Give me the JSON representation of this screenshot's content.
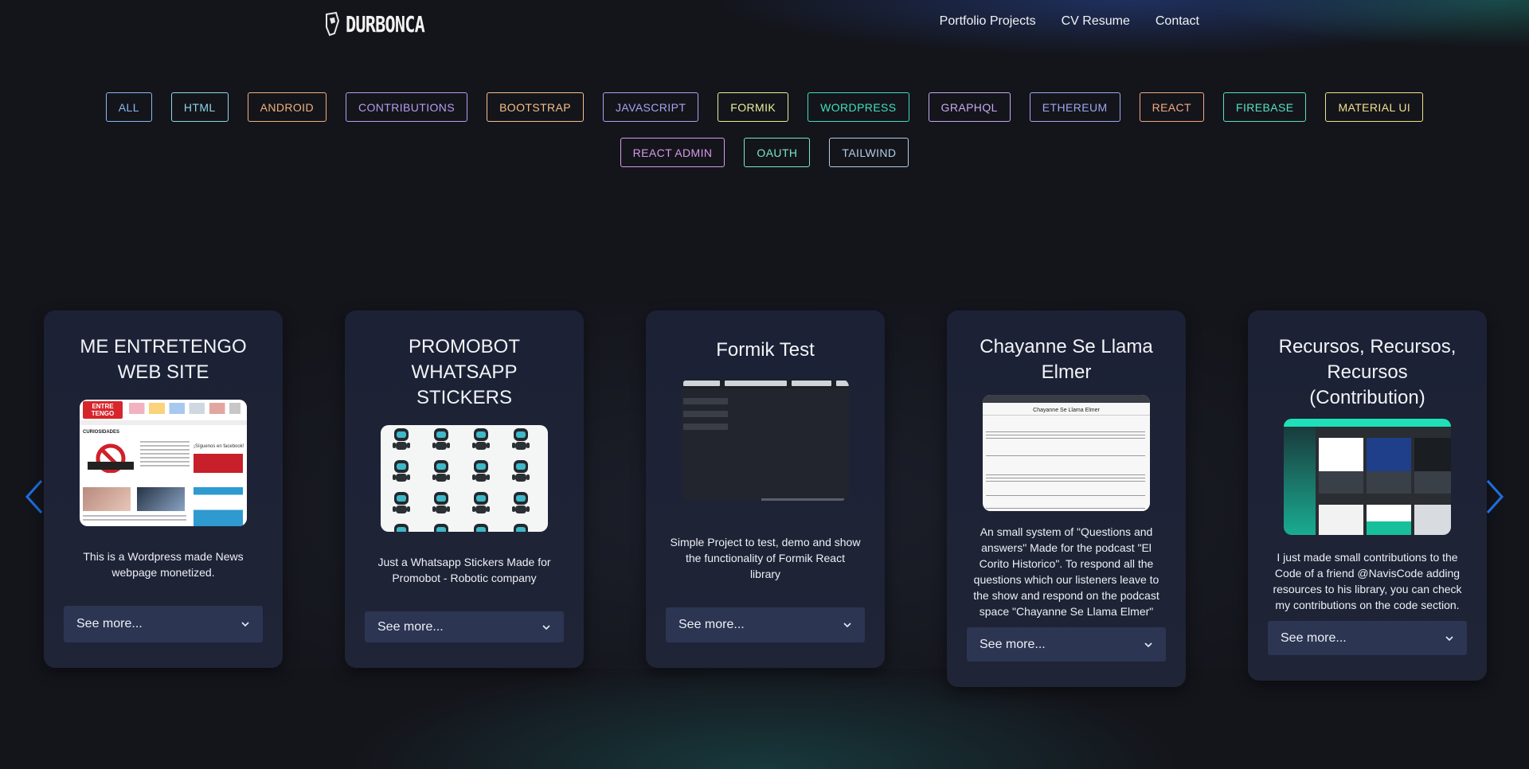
{
  "header": {
    "logo_text": "DURBONCA",
    "nav": [
      "Portfolio Projects",
      "CV Resume",
      "Contact"
    ]
  },
  "filters": [
    {
      "label": "ALL",
      "color": "#8ab8f0"
    },
    {
      "label": "HTML",
      "color": "#8cd6ea"
    },
    {
      "label": "ANDROID",
      "color": "#f0b27a"
    },
    {
      "label": "CONTRIBUTIONS",
      "color": "#b89cf0"
    },
    {
      "label": "BOOTSTRAP",
      "color": "#f2c18a"
    },
    {
      "label": "JAVASCRIPT",
      "color": "#a6a4f0"
    },
    {
      "label": "FORMIK",
      "color": "#e8ee9a"
    },
    {
      "label": "WORDPRESS",
      "color": "#3fe0bf"
    },
    {
      "label": "GRAPHQL",
      "color": "#c7a9f0"
    },
    {
      "label": "ETHEREUM",
      "color": "#9ea8f2"
    },
    {
      "label": "REACT",
      "color": "#f4a882"
    },
    {
      "label": "FIREBASE",
      "color": "#57e0c4"
    },
    {
      "label": "MATERIAL UI",
      "color": "#f3e08e"
    },
    {
      "label": "REACT ADMIN",
      "color": "#d79ae8"
    },
    {
      "label": "OAUTH",
      "color": "#7ae8c9"
    },
    {
      "label": "TAILWIND",
      "color": "#b2cde8"
    }
  ],
  "cards": [
    {
      "title": "ME ENTRETENGO WEB SITE",
      "description": "This is a Wordpress made News webpage monetized.",
      "button": "See more..."
    },
    {
      "title": "PROMOBOT WHATSAPP STICKERS",
      "description": "Just a Whatsapp Stickers Made for Promobot - Robotic company",
      "button": "See more..."
    },
    {
      "title": "Formik Test",
      "description": "Simple Project to test, demo and show the functionality of Formik React library",
      "button": "See more..."
    },
    {
      "title": "Chayanne Se Llama Elmer",
      "description": "An small system of \"Questions and answers\" Made for the podcast \"El Corito Historico\". To respond all the questions which our listeners leave to the show and respond on the podcast space \"Chayanne Se Llama Elmer\"",
      "button": "See more..."
    },
    {
      "title": "Recursos, Recursos, Recursos (Contribution)",
      "description": "I just made small contributions to the Code of a friend @NavisCode adding resources to his library, you can check my contributions on the code section.",
      "button": "See more..."
    }
  ],
  "thumbs": {
    "t1_brand": "ENTRE TENGO",
    "t1_section": "CURIOSIDADES",
    "t1_side": "¡Síguenos en facebook!",
    "t4_heading": "Chayanne Se Llama Elmer"
  },
  "colors": {
    "background": "#14151b",
    "card": "#1c2135",
    "button": "#2c3552",
    "arrow": "#1e6fe0"
  }
}
